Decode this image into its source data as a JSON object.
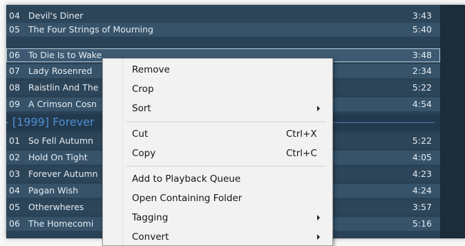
{
  "playlist": {
    "rows_before": [
      {
        "num": "04",
        "title": "Devil's Diner",
        "duration": "3:43"
      },
      {
        "num": "05",
        "title": "The Four Strings of Mourning",
        "duration": "5:40"
      },
      {
        "num": "06",
        "title": "To Die Is to Wake",
        "duration": "3:48"
      },
      {
        "num": "07",
        "title": "Lady Rosenred",
        "duration": "2:34"
      },
      {
        "num": "08",
        "title": "Raistlin And The",
        "duration": "5:22"
      },
      {
        "num": "09",
        "title": "A Crimson Cosn",
        "duration": "4:54"
      }
    ],
    "group_header": "- [1999] Forever",
    "rows_after": [
      {
        "num": "01",
        "title": "So Fell Autumn",
        "duration": "5:22"
      },
      {
        "num": "02",
        "title": "Hold On Tight",
        "duration": "4:05"
      },
      {
        "num": "03",
        "title": "Forever Autumn",
        "duration": "4:23"
      },
      {
        "num": "04",
        "title": "Pagan Wish",
        "duration": "4:24"
      },
      {
        "num": "05",
        "title": "Otherwheres",
        "duration": "3:57"
      },
      {
        "num": "06",
        "title": "The Homecomi",
        "duration": "5:16"
      }
    ]
  },
  "context_menu": {
    "remove": "Remove",
    "crop": "Crop",
    "sort": "Sort",
    "cut": "Cut",
    "cut_shortcut": "Ctrl+X",
    "copy": "Copy",
    "copy_shortcut": "Ctrl+C",
    "add_queue": "Add to Playback Queue",
    "open_folder": "Open Containing Folder",
    "tagging": "Tagging",
    "convert": "Convert"
  },
  "icons": {
    "submenu": "chevron-right-icon"
  },
  "colors": {
    "playlist_bg": "#2a4256",
    "row_alt": "#36536a",
    "group_text": "#4f8fd4",
    "menu_bg": "#f2f2f2"
  }
}
